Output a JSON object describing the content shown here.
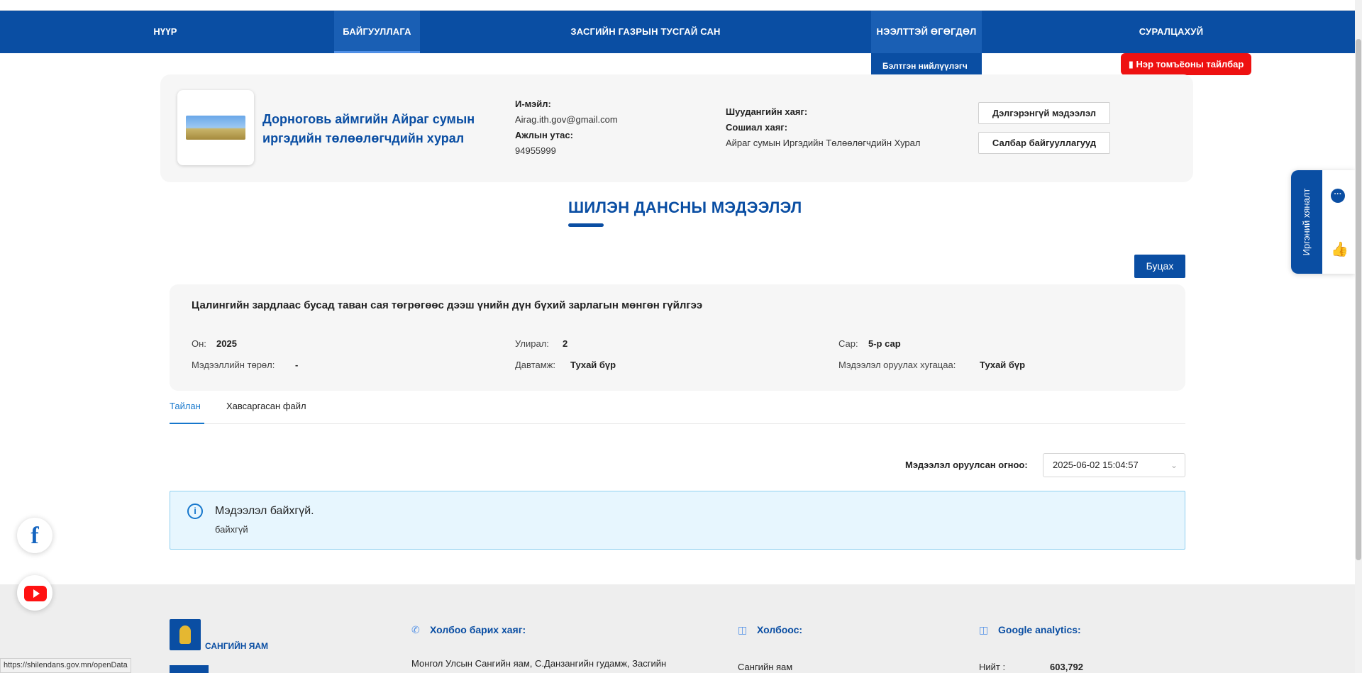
{
  "nav": {
    "items": [
      {
        "label": "НҮҮР"
      },
      {
        "label": "БАЙГУУЛЛАГА"
      },
      {
        "label": "ЗАСГИЙН ГАЗРЫН ТУСГАЙ САН"
      },
      {
        "label": "НЭЭЛТТЭЙ ӨГӨГДӨЛ"
      },
      {
        "label": "СУРАЛЦАХУЙ"
      }
    ],
    "dropdown_item": "Бэлтгэн нийлүүлэгч"
  },
  "glossary_button": "Нэр томъёоны тайлбар",
  "org": {
    "name": "Дорноговь аймгийн Айраг сумын иргэдийн төлөөлөгчдийн хурал",
    "email_label": "И-мэйл:",
    "email": "Airag.ith.gov@gmail.com",
    "phone_label": "Ажлын утас:",
    "phone": "94955999",
    "fax_label": "Шуудангийн хаяг:",
    "social_label": "Сошиал хаяг:",
    "social_value": "Айраг сумын Иргэдийн Төлөөлөгчдийн Хурал",
    "details_button": "Дэлгэрэнгүй мэдээлэл",
    "branches_button": "Салбар байгууллагууд"
  },
  "section_title": "ШИЛЭН ДАНСНЫ МЭДЭЭЛЭЛ",
  "back_button": "Буцах",
  "detail": {
    "title": "Цалингийн зардлаас бусад таван сая төгрөгөөс дээш үнийн дүн бүхий зарлагын мөнгөн гүйлгээ",
    "year_label": "Он:",
    "year": "2025",
    "quarter_label": "Улирал:",
    "quarter": "2",
    "month_label": "Сар:",
    "month": "5-р сар",
    "type_label": "Мэдээллийн төрөл:",
    "type": "-",
    "freq_label": "Давтамж:",
    "freq": "Тухай бүр",
    "deadline_label": "Мэдээлэл оруулах хугацаа:",
    "deadline": "Тухай бүр"
  },
  "tabs": [
    {
      "label": "Тайлан"
    },
    {
      "label": "Хавсаргасан файл"
    }
  ],
  "upload_date_label": "Мэдээлэл оруулсан огноо:",
  "upload_date_value": "2025-06-02 15:04:57",
  "alert": {
    "title": "Мэдээлэл байхгүй.",
    "description": "байхгүй"
  },
  "footer": {
    "org_name": "САНГИЙН ЯАМ",
    "contact_heading": "Холбоо барих хаяг:",
    "contact_text": "Монгол Улсын Сангийн яам, С.Данзангийн гудамж, Засгийн",
    "links_heading": "Холбоос:",
    "links_item": "Сангийн яам",
    "analytics_heading": "Google analytics:",
    "analytics_label": "Нийт :",
    "analytics_value": "603,792"
  },
  "feedback_label": "Иргэний хяналт",
  "status_url": "https://shilendans.gov.mn/openData",
  "colors": {
    "brand": "#0a4ea3",
    "alert_bg": "#e7f6fe",
    "red": "#ee1111"
  }
}
